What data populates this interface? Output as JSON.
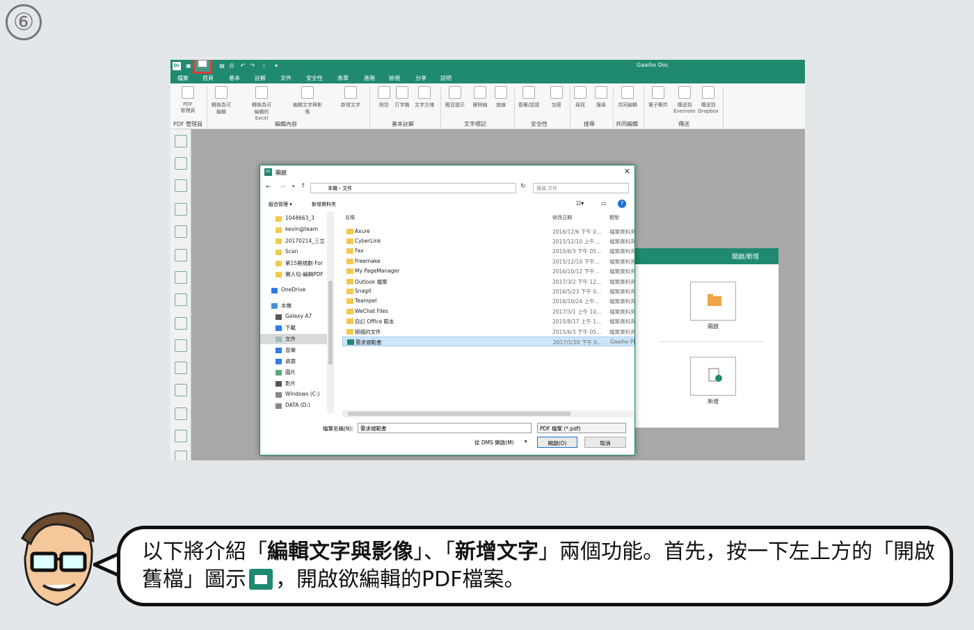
{
  "step_number": "⑥",
  "app": {
    "title": "Gaaiho Doc",
    "logo": "Dc",
    "menu": [
      "檔案",
      "首頁",
      "基本",
      "註解",
      "文件",
      "安全性",
      "表單",
      "進階",
      "檢視",
      "分享",
      "說明"
    ],
    "ribbon": {
      "buttons": [
        "PDF\n管理員",
        "轉換為可編輯",
        "轉換為可編輯的\nExcel",
        "編輯文字與影像",
        "新增文字",
        "附註",
        "打字機",
        "文字方塊",
        "醒目提示",
        "刪除線",
        "底線",
        "簽署/認證",
        "加密",
        "尋找",
        "搜尋",
        "共同編輯",
        "電子郵件",
        "傳送到\nEvernote",
        "傳送到\nDropbox"
      ],
      "groups": [
        "PDF 管理員",
        "編輯內容",
        "基本註解",
        "文字標記",
        "安全性",
        "搜尋",
        "共同編輯",
        "傳送"
      ]
    },
    "panel": {
      "header": "開啟/新增",
      "open_label": "開啟",
      "new_label": "新增"
    }
  },
  "dialog": {
    "title": "開啟",
    "breadcrumb": [
      "本機",
      "文件"
    ],
    "search_placeholder": "搜尋 文件",
    "organize": "組合管理 ▾",
    "new_folder": "新增資料夾",
    "nav": [
      "1048663_3",
      "kevin@team",
      "20170214_三立",
      "Scan",
      "第15期規劃-For",
      "懶人包-編輯PDF",
      "OneDrive",
      "本機",
      "Galaxy A7",
      "下載",
      "文件",
      "音樂",
      "桌面",
      "圖片",
      "影片",
      "Windows (C:)",
      "DATA (D:)"
    ],
    "columns": [
      "名稱",
      "修改日期",
      "類型"
    ],
    "files": [
      {
        "name": "Axure",
        "date": "2016/12/6 下午 0...",
        "type": "檔案資料夾"
      },
      {
        "name": "CyberLink",
        "date": "2015/12/10 上午...",
        "type": "檔案資料夾"
      },
      {
        "name": "Fax",
        "date": "2015/6/3 下午 05...",
        "type": "檔案資料夾"
      },
      {
        "name": "Freemake",
        "date": "2015/12/10 下午...",
        "type": "檔案資料夾"
      },
      {
        "name": "My PageManager",
        "date": "2016/10/12 下午...",
        "type": "檔案資料夾"
      },
      {
        "name": "Outlook 檔案",
        "date": "2017/3/2 下午 12...",
        "type": "檔案資料夾"
      },
      {
        "name": "Snagit",
        "date": "2016/5/23 下午 0...",
        "type": "檔案資料夾"
      },
      {
        "name": "Teampel",
        "date": "2016/10/24 上午...",
        "type": "檔案資料夾"
      },
      {
        "name": "WeChat Files",
        "date": "2017/3/1 上午 10...",
        "type": "檔案資料夾"
      },
      {
        "name": "自訂 Office 範本",
        "date": "2015/8/17 上午 1...",
        "type": "檔案資料夾"
      },
      {
        "name": "掃描的文件",
        "date": "2015/6/3 下午 05...",
        "type": "檔案資料夾"
      },
      {
        "name": "需求規範書",
        "date": "2017/1/10 下午 0...",
        "type": "Gaaiho PDF"
      }
    ],
    "filename_label": "檔案名稱(N):",
    "filename_value": "需求規範書",
    "filetype_value": "PDF 檔案 (*.pdf)",
    "dms_label": "從 DMS 開啟(M)",
    "open_button": "開啟(O)",
    "cancel_button": "取消"
  },
  "speech": {
    "p1": "以下將介紹「",
    "b1": "編輯文字與影像",
    "p2": "」、「",
    "b2": "新增文字",
    "p3": "」兩個功能。首先，按一下左上方的「開啟舊檔」圖示",
    "p4": "，開啟欲編輯的PDF檔案。"
  },
  "colors": {
    "brand": "#1f8a6f",
    "highlight": "#e53935"
  }
}
